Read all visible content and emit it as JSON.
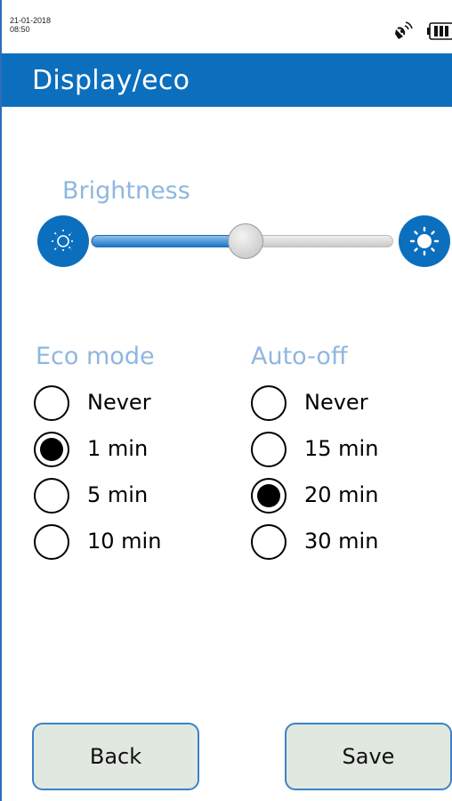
{
  "status_bar": {
    "date": "21-01-2018",
    "time": "08:50",
    "icons": [
      "satellite-icon",
      "battery-icon"
    ]
  },
  "header": {
    "title": "Display/eco"
  },
  "brightness": {
    "label": "Brightness",
    "value_fraction": 0.5,
    "low_icon": "sun-dim-icon",
    "high_icon": "sun-bright-icon"
  },
  "eco_mode": {
    "label": "Eco mode",
    "options": [
      "Never",
      "1 min",
      "5 min",
      "10 min"
    ],
    "selected": "1 min"
  },
  "auto_off": {
    "label": "Auto-off",
    "options": [
      "Never",
      "15 min",
      "20 min",
      "30 min"
    ],
    "selected": "20 min"
  },
  "footer": {
    "back_label": "Back",
    "save_label": "Save"
  },
  "colors": {
    "accent": "#0c6fbd",
    "label": "#8fb7df",
    "button_bg": "#e1e8e0",
    "button_border": "#3b83c6"
  }
}
